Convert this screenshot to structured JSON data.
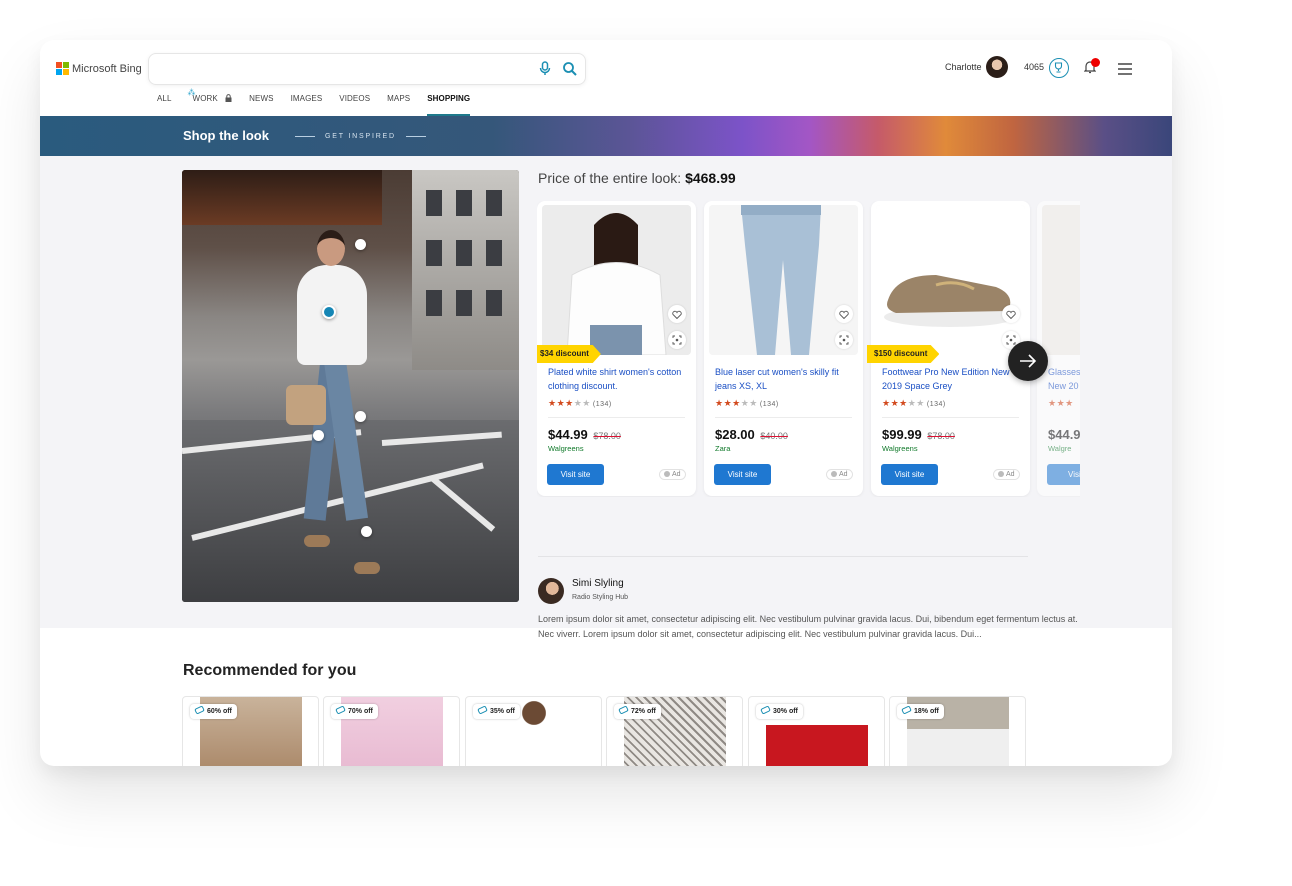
{
  "header": {
    "brand": "Microsoft Bing",
    "search": {
      "value": "",
      "placeholder": ""
    },
    "tabs": [
      {
        "label": "ALL"
      },
      {
        "label": "WORK"
      },
      {
        "label": "NEWS"
      },
      {
        "label": "IMAGES"
      },
      {
        "label": "VIDEOS"
      },
      {
        "label": "MAPS"
      },
      {
        "label": "SHOPPING",
        "active": true
      }
    ],
    "user_name": "Charlotte",
    "points": "4065"
  },
  "banner": {
    "title": "Shop the look",
    "subtitle": "GET INSPIRED"
  },
  "look": {
    "price_label": "Price of the entire look:",
    "price_total": "$468.99"
  },
  "products": [
    {
      "badge": "$34 discount",
      "title": "Plated white shirt women's cotton clothing discount.",
      "rating": 3,
      "reviews": "(134)",
      "price": "$44.99",
      "old_price": "$78.00",
      "store": "Walgreens",
      "cta": "Visit site",
      "ad": "Ad"
    },
    {
      "badge": "",
      "title": "Blue laser cut women's skilly fit jeans XS, XL",
      "rating": 3,
      "reviews": "(134)",
      "price": "$28.00",
      "old_price": "$40.00",
      "store": "Zara",
      "cta": "Visit site",
      "ad": "Ad"
    },
    {
      "badge": "$150 discount",
      "title": "Foottwear Pro New Edition New 2019 Space Grey",
      "rating": 3,
      "reviews": "(134)",
      "price": "$99.99",
      "old_price": "$78.00",
      "store": "Walgreens",
      "cta": "Visit site",
      "ad": "Ad"
    },
    {
      "badge": "",
      "title": "Glasses New 20",
      "rating": 3,
      "reviews": "",
      "price": "$44.9",
      "old_price": "",
      "store": "Walgre",
      "cta": "Visit",
      "ad": ""
    }
  ],
  "stylist": {
    "name": "Simi Slyling",
    "org": "Radio Styling Hub",
    "description": "Lorem ipsum dolor sit amet, consectetur adipiscing elit. Nec vestibulum pulvinar gravida lacus. Dui, bibendum eget fermentum lectus at. Nec viverr. Lorem ipsum dolor sit amet, consectetur adipiscing elit. Nec vestibulum pulvinar gravida lacus. Dui..."
  },
  "recommended": {
    "title": "Recommended for you",
    "items": [
      {
        "badge": "60% off"
      },
      {
        "badge": "70% off"
      },
      {
        "badge": "35% off"
      },
      {
        "badge": "72% off"
      },
      {
        "badge": "30% off"
      },
      {
        "badge": "18% off"
      }
    ]
  },
  "colors": {
    "accent": "#1f78d1",
    "link": "#1a4fc4",
    "discount_badge": "#ffd400",
    "store_green": "#117a2b",
    "star": "#d24a1e",
    "hotspot_active": "#1586b5"
  }
}
